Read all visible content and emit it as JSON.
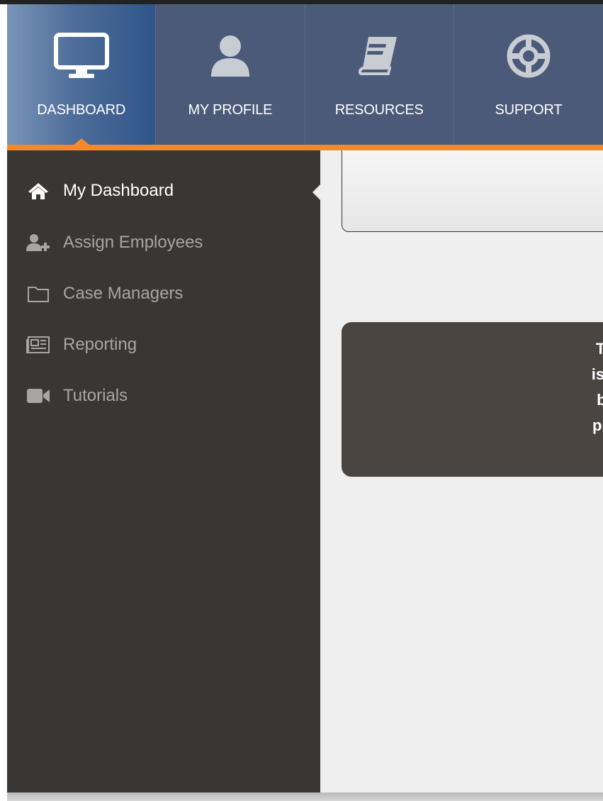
{
  "nav": {
    "tabs": [
      {
        "label": "DASHBOARD",
        "icon": "monitor-icon",
        "active": true
      },
      {
        "label": "MY PROFILE",
        "icon": "user-icon",
        "active": false
      },
      {
        "label": "RESOURCES",
        "icon": "book-icon",
        "active": false
      },
      {
        "label": "SUPPORT",
        "icon": "lifebuoy-icon",
        "active": false
      }
    ]
  },
  "sidebar": {
    "items": [
      {
        "label": "My Dashboard",
        "icon": "home-icon",
        "active": true
      },
      {
        "label": "Assign Employees",
        "icon": "add-user-icon",
        "active": false
      },
      {
        "label": "Case Managers",
        "icon": "folder-icon",
        "active": false
      },
      {
        "label": "Reporting",
        "icon": "newspaper-icon",
        "active": false
      },
      {
        "label": "Tutorials",
        "icon": "video-camera-icon",
        "active": false
      }
    ]
  },
  "main": {
    "message_lines": [
      "The",
      "is to",
      "by i",
      "plac"
    ]
  },
  "colors": {
    "nav_background": "#4a5a78",
    "accent": "#f5892a",
    "sidebar_background": "#3a3633",
    "message_box": "#4b4541"
  }
}
